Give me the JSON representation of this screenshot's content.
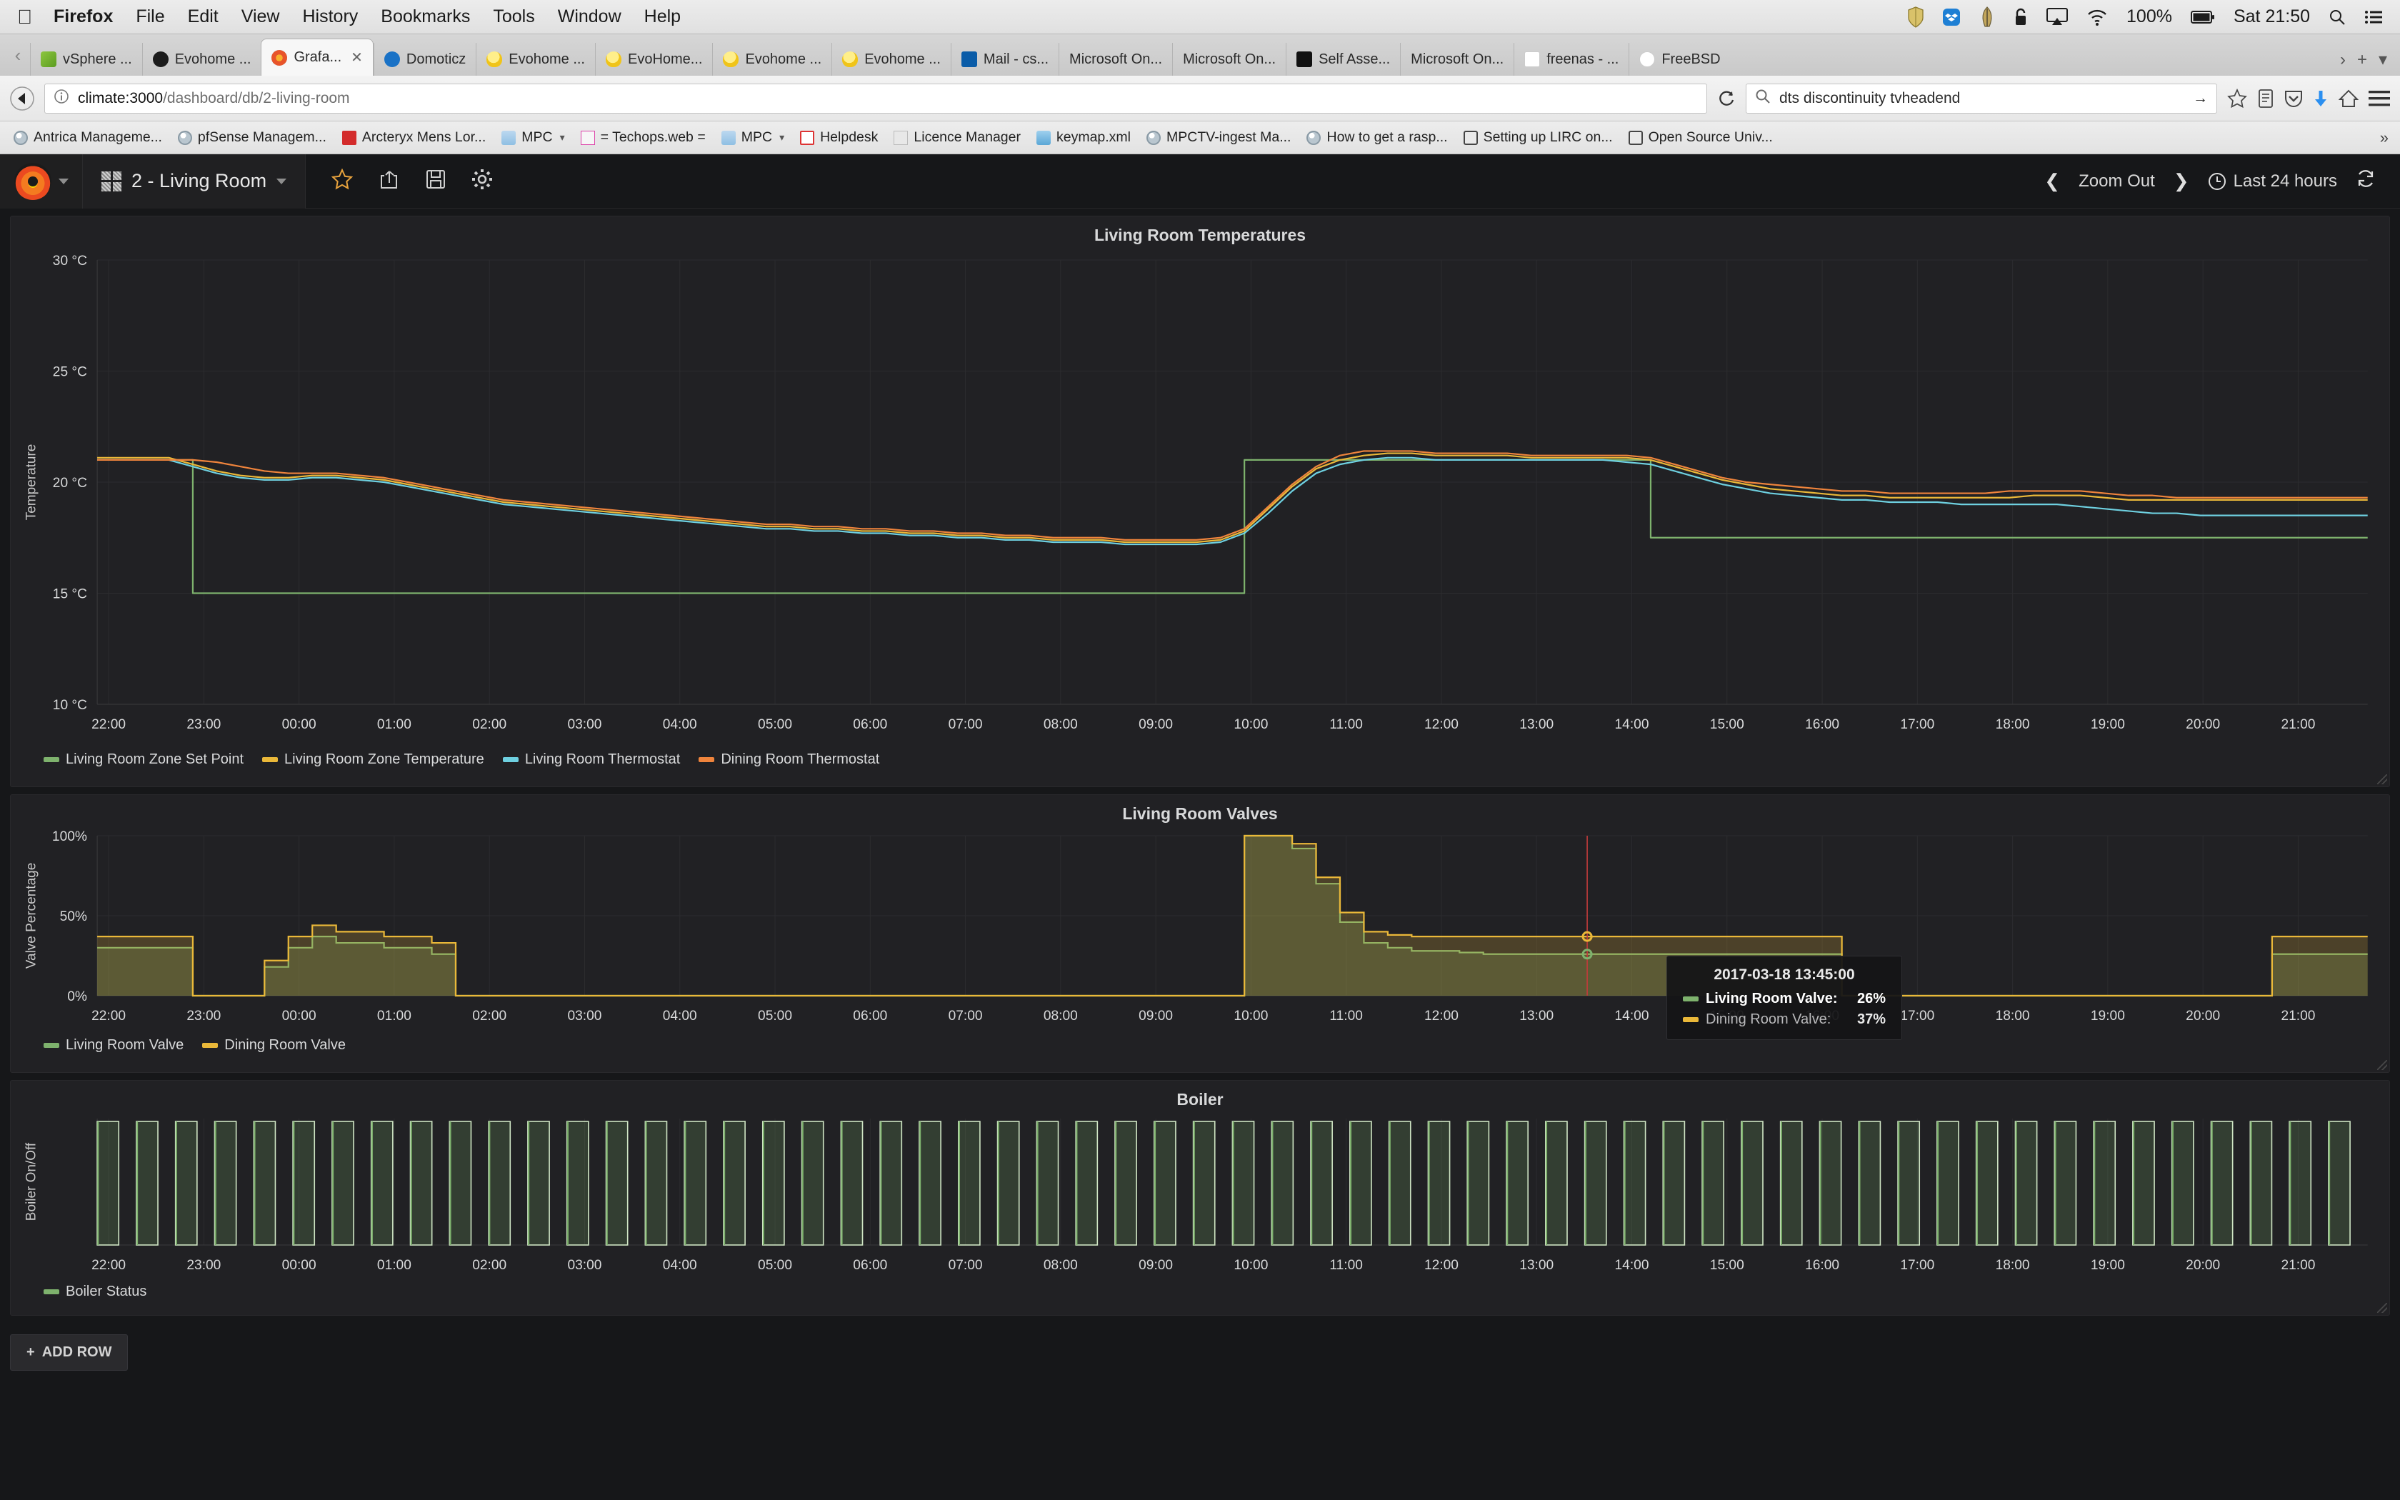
{
  "macbar": {
    "apple_icon": "apple-icon",
    "menus": [
      "Firefox",
      "File",
      "Edit",
      "View",
      "History",
      "Bookmarks",
      "Tools",
      "Window",
      "Help"
    ],
    "status_icons": [
      "shield-icon",
      "dropbox-icon",
      "feather-icon",
      "lock-icon",
      "airplay-icon",
      "wifi-icon"
    ],
    "battery": "100%",
    "clock": "Sat 21:50",
    "search_icon": "search-icon",
    "list_icon": "list-icon"
  },
  "tabstrip": {
    "back_arrow": "‹",
    "tabs": [
      {
        "label": "vSphere ...",
        "icon": "vsphere-icon",
        "icon_class": "fav-vs",
        "active": false
      },
      {
        "label": "Evohome ...",
        "icon": "github-icon",
        "icon_class": "fav-gh",
        "active": false
      },
      {
        "label": "Grafa...",
        "icon": "grafana-icon",
        "icon_class": "fav-graf",
        "active": true
      },
      {
        "label": "Domoticz",
        "icon": "domoticz-icon",
        "icon_class": "fav-domo",
        "active": false
      },
      {
        "label": "Evohome ...",
        "icon": "bulb-icon",
        "icon_class": "fav-bulb",
        "active": false
      },
      {
        "label": "EvoHome...",
        "icon": "bulb-icon",
        "icon_class": "fav-bulb",
        "active": false
      },
      {
        "label": "Evohome ...",
        "icon": "bulb-icon",
        "icon_class": "fav-bulb",
        "active": false
      },
      {
        "label": "Evohome ...",
        "icon": "bulb-icon",
        "icon_class": "fav-bulb",
        "active": false
      },
      {
        "label": "Mail - cs...",
        "icon": "outlook-icon",
        "icon_class": "fav-mail",
        "active": false
      },
      {
        "label": "Microsoft On...",
        "icon": "none",
        "icon_class": "",
        "active": false
      },
      {
        "label": "Microsoft On...",
        "icon": "none",
        "icon_class": "",
        "active": false
      },
      {
        "label": "Self Asse...",
        "icon": "crown-icon",
        "icon_class": "fav-crown",
        "active": false
      },
      {
        "label": "Microsoft On...",
        "icon": "none",
        "icon_class": "",
        "active": false
      },
      {
        "label": "freenas - ...",
        "icon": "freenas-icon",
        "icon_class": "fav-fn",
        "active": false
      },
      {
        "label": "FreeBSD",
        "icon": "freebsd-icon",
        "icon_class": "fav-bsd",
        "active": false
      }
    ],
    "close_glyph": "✕",
    "overflow_arrow": "›",
    "new_tab": "+",
    "tab_list": "▾"
  },
  "navbar": {
    "back_icon": "back-arrow-icon",
    "info_icon": "page-info-icon",
    "url_host": "climate:3000",
    "url_path": "/dashboard/db/2-living-room",
    "reload_icon": "reload-icon",
    "search_icon": "search-icon",
    "search_value": "dts discontinuity tvheadend",
    "search_go": "→",
    "bookmark_icon": "star-icon",
    "reader_icon": "reader-view-icon",
    "pocket_icon": "pocket-icon",
    "downloads_icon": "download-icon",
    "home_icon": "home-icon",
    "menu_icon": "hamburger-menu-icon"
  },
  "bookmarks": [
    {
      "label": "Antrica Manageme...",
      "icon": "globe-icon",
      "icon_class": "fav-globe",
      "chevron": false
    },
    {
      "label": "pfSense Managem...",
      "icon": "globe-icon",
      "icon_class": "fav-globe",
      "chevron": false
    },
    {
      "label": "Arcteryx Mens Lor...",
      "icon": "acrobat-icon",
      "icon_class": "ico-acrobat",
      "chevron": false
    },
    {
      "label": "MPC",
      "icon": "folder-icon",
      "icon_class": "ico-folder",
      "chevron": true
    },
    {
      "label": "= Techops.web =",
      "icon": "techops-icon",
      "icon_class": "ico-to",
      "chevron": false
    },
    {
      "label": "MPC",
      "icon": "folder-icon",
      "icon_class": "ico-folder",
      "chevron": true
    },
    {
      "label": "Helpdesk",
      "icon": "checkbox-icon",
      "icon_class": "ico-check",
      "chevron": false
    },
    {
      "label": "Licence Manager",
      "icon": "mpc-icon",
      "icon_class": "ico-mpc",
      "chevron": false
    },
    {
      "label": "keymap.xml",
      "icon": "keymap-icon",
      "icon_class": "ico-key",
      "chevron": false
    },
    {
      "label": "MPCTV-ingest Ma...",
      "icon": "globe-icon",
      "icon_class": "fav-globe",
      "chevron": false
    },
    {
      "label": "How to get a rasp...",
      "icon": "globe-icon",
      "icon_class": "fav-globe",
      "chevron": false
    },
    {
      "label": "Setting up LIRC on...",
      "icon": "doc-icon",
      "icon_class": "ico-sq",
      "chevron": false
    },
    {
      "label": "Open Source Univ...",
      "icon": "doc-icon",
      "icon_class": "ico-sq",
      "chevron": false
    }
  ],
  "bookmarks_overflow": "»",
  "grafana": {
    "logo_icon": "grafana-logo-icon",
    "dashboard_grid_icon": "dashboard-grid-icon",
    "dashboard_title": "2 - Living Room",
    "tools": [
      {
        "name": "star-icon",
        "glyph": "☆"
      },
      {
        "name": "share-icon",
        "glyph": "➶"
      },
      {
        "name": "save-icon",
        "glyph": "Ὃe"
      },
      {
        "name": "settings-gear-icon",
        "glyph": "⚙"
      }
    ],
    "zoom_prev": "❮",
    "zoom_out_label": "Zoom Out",
    "zoom_next": "❯",
    "clock_icon": "clock-icon",
    "time_range": "Last 24 hours",
    "refresh_icon": "refresh-icon",
    "add_row_label": "ADD ROW",
    "add_row_plus": "+"
  },
  "tooltip": {
    "time": "2017-03-18 13:45:00",
    "rows": [
      {
        "label": "Living Room Valve:",
        "value": "26%",
        "color": "#7eb26d",
        "highlight": true
      },
      {
        "label": "Dining Room Valve:",
        "value": "37%",
        "color": "#eab839",
        "highlight": false
      }
    ]
  },
  "chart_data": [
    {
      "type": "line",
      "title": "Living Room Temperatures",
      "ylabel": "Temperature",
      "xlabel": "",
      "ylim": [
        10,
        30
      ],
      "yticks": [
        10,
        15,
        20,
        25,
        30
      ],
      "ytick_labels": [
        "10 °C",
        "15 °C",
        "20 °C",
        "25 °C",
        "30 °C"
      ],
      "xtick_labels": [
        "22:00",
        "23:00",
        "00:00",
        "01:00",
        "02:00",
        "03:00",
        "04:00",
        "05:00",
        "06:00",
        "07:00",
        "08:00",
        "09:00",
        "10:00",
        "11:00",
        "12:00",
        "13:00",
        "14:00",
        "15:00",
        "16:00",
        "17:00",
        "18:00",
        "19:00",
        "20:00",
        "21:00"
      ],
      "grid": true,
      "legend_position": "bottom",
      "series": [
        {
          "name": "Living Room Zone Set Point",
          "color": "#7eb26d",
          "values": [
            21.0,
            21.0,
            21.0,
            21.0,
            15.0,
            15.0,
            15.0,
            15.0,
            15.0,
            15.0,
            15.0,
            15.0,
            15.0,
            15.0,
            15.0,
            15.0,
            15.0,
            15.0,
            15.0,
            15.0,
            15.0,
            15.0,
            15.0,
            15.0,
            15.0,
            15.0,
            15.0,
            15.0,
            15.0,
            15.0,
            15.0,
            15.0,
            15.0,
            15.0,
            15.0,
            15.0,
            15.0,
            15.0,
            15.0,
            15.0,
            15.0,
            15.0,
            15.0,
            15.0,
            15.0,
            15.0,
            15.0,
            15.0,
            21.0,
            21.0,
            21.0,
            21.0,
            21.0,
            21.0,
            21.0,
            21.0,
            21.0,
            21.0,
            21.0,
            21.0,
            21.0,
            21.0,
            21.0,
            21.0,
            21.0,
            17.5,
            17.5,
            17.5,
            17.5,
            17.5,
            17.5,
            17.5,
            17.5,
            17.5,
            17.5,
            17.5,
            17.5,
            17.5,
            17.5,
            17.5,
            17.5,
            17.5,
            17.5,
            17.5,
            17.5,
            17.5,
            17.5,
            17.5,
            17.5,
            17.5,
            17.5,
            17.5,
            17.5,
            17.5,
            17.5,
            17.5
          ]
        },
        {
          "name": "Living Room Zone Temperature",
          "color": "#eab839",
          "values": [
            21.1,
            21.1,
            21.1,
            21.1,
            20.8,
            20.5,
            20.3,
            20.2,
            20.2,
            20.3,
            20.3,
            20.2,
            20.1,
            19.9,
            19.7,
            19.5,
            19.3,
            19.1,
            19.0,
            18.9,
            18.8,
            18.7,
            18.6,
            18.5,
            18.4,
            18.3,
            18.2,
            18.1,
            18.0,
            18.0,
            17.9,
            17.9,
            17.8,
            17.8,
            17.7,
            17.7,
            17.6,
            17.6,
            17.5,
            17.5,
            17.4,
            17.4,
            17.4,
            17.3,
            17.3,
            17.3,
            17.3,
            17.4,
            17.8,
            18.8,
            19.8,
            20.6,
            21.0,
            21.2,
            21.3,
            21.3,
            21.2,
            21.2,
            21.2,
            21.2,
            21.1,
            21.1,
            21.1,
            21.1,
            21.1,
            21.0,
            20.7,
            20.4,
            20.1,
            19.9,
            19.7,
            19.6,
            19.5,
            19.4,
            19.4,
            19.3,
            19.3,
            19.3,
            19.3,
            19.3,
            19.3,
            19.4,
            19.4,
            19.4,
            19.3,
            19.2,
            19.2,
            19.2,
            19.2,
            19.2,
            19.2,
            19.2,
            19.2,
            19.2,
            19.2,
            19.2
          ]
        },
        {
          "name": "Living Room Thermostat",
          "color": "#6ed0e0",
          "values": [
            21.0,
            21.0,
            21.0,
            21.0,
            20.7,
            20.4,
            20.2,
            20.1,
            20.1,
            20.2,
            20.2,
            20.1,
            20.0,
            19.8,
            19.6,
            19.4,
            19.2,
            19.0,
            18.9,
            18.8,
            18.7,
            18.6,
            18.5,
            18.4,
            18.3,
            18.2,
            18.1,
            18.0,
            17.9,
            17.9,
            17.8,
            17.8,
            17.7,
            17.7,
            17.6,
            17.6,
            17.5,
            17.5,
            17.4,
            17.4,
            17.3,
            17.3,
            17.3,
            17.2,
            17.2,
            17.2,
            17.2,
            17.3,
            17.7,
            18.6,
            19.6,
            20.4,
            20.8,
            21.0,
            21.1,
            21.1,
            21.0,
            21.0,
            21.0,
            21.0,
            21.0,
            21.0,
            21.0,
            21.0,
            20.9,
            20.8,
            20.5,
            20.2,
            19.9,
            19.7,
            19.5,
            19.4,
            19.3,
            19.2,
            19.2,
            19.1,
            19.1,
            19.1,
            19.0,
            19.0,
            19.0,
            19.0,
            19.0,
            18.9,
            18.8,
            18.7,
            18.6,
            18.6,
            18.5,
            18.5,
            18.5,
            18.5,
            18.5,
            18.5,
            18.5,
            18.5
          ]
        },
        {
          "name": "Dining Room Thermostat",
          "color": "#ef843c",
          "values": [
            21.0,
            21.0,
            21.0,
            21.0,
            21.0,
            20.9,
            20.7,
            20.5,
            20.4,
            20.4,
            20.4,
            20.3,
            20.2,
            20.0,
            19.8,
            19.6,
            19.4,
            19.2,
            19.1,
            19.0,
            18.9,
            18.8,
            18.7,
            18.6,
            18.5,
            18.4,
            18.3,
            18.2,
            18.1,
            18.1,
            18.0,
            18.0,
            17.9,
            17.9,
            17.8,
            17.8,
            17.7,
            17.7,
            17.6,
            17.6,
            17.5,
            17.5,
            17.5,
            17.4,
            17.4,
            17.4,
            17.4,
            17.5,
            17.9,
            18.9,
            19.9,
            20.7,
            21.2,
            21.4,
            21.4,
            21.4,
            21.3,
            21.3,
            21.3,
            21.3,
            21.2,
            21.2,
            21.2,
            21.2,
            21.2,
            21.1,
            20.8,
            20.5,
            20.2,
            20.0,
            19.9,
            19.8,
            19.7,
            19.6,
            19.6,
            19.5,
            19.5,
            19.5,
            19.5,
            19.5,
            19.6,
            19.6,
            19.6,
            19.6,
            19.5,
            19.4,
            19.4,
            19.3,
            19.3,
            19.3,
            19.3,
            19.3,
            19.3,
            19.3,
            19.3,
            19.3
          ]
        }
      ]
    },
    {
      "type": "area",
      "title": "Living Room Valves",
      "ylabel": "Valve Percentage",
      "xlabel": "",
      "ylim": [
        0,
        100
      ],
      "yticks": [
        0,
        50,
        100
      ],
      "ytick_labels": [
        "0%",
        "50%",
        "100%"
      ],
      "xtick_labels": [
        "22:00",
        "23:00",
        "00:00",
        "01:00",
        "02:00",
        "03:00",
        "04:00",
        "05:00",
        "06:00",
        "07:00",
        "08:00",
        "09:00",
        "10:00",
        "11:00",
        "12:00",
        "13:00",
        "14:00",
        "15:00",
        "16:00",
        "17:00",
        "18:00",
        "19:00",
        "20:00",
        "21:00"
      ],
      "grid": true,
      "legend_position": "bottom",
      "series": [
        {
          "name": "Living Room Valve",
          "color": "#7eb26d",
          "values": [
            30,
            30,
            30,
            30,
            0,
            0,
            0,
            18,
            30,
            37,
            33,
            33,
            30,
            30,
            26,
            0,
            0,
            0,
            0,
            0,
            0,
            0,
            0,
            0,
            0,
            0,
            0,
            0,
            0,
            0,
            0,
            0,
            0,
            0,
            0,
            0,
            0,
            0,
            0,
            0,
            0,
            0,
            0,
            0,
            0,
            0,
            0,
            0,
            100,
            100,
            92,
            70,
            46,
            33,
            30,
            28,
            28,
            27,
            26,
            26,
            26,
            26,
            26,
            26,
            26,
            26,
            26,
            26,
            26,
            26,
            26,
            26,
            26,
            0,
            0,
            0,
            0,
            0,
            0,
            0,
            0,
            0,
            0,
            0,
            0,
            0,
            0,
            0,
            0,
            0,
            0,
            26,
            26,
            26,
            26,
            26
          ]
        },
        {
          "name": "Dining Room Valve",
          "color": "#eab839",
          "values": [
            37,
            37,
            37,
            37,
            0,
            0,
            0,
            22,
            37,
            44,
            40,
            40,
            37,
            37,
            33,
            0,
            0,
            0,
            0,
            0,
            0,
            0,
            0,
            0,
            0,
            0,
            0,
            0,
            0,
            0,
            0,
            0,
            0,
            0,
            0,
            0,
            0,
            0,
            0,
            0,
            0,
            0,
            0,
            0,
            0,
            0,
            0,
            0,
            100,
            100,
            95,
            74,
            52,
            40,
            38,
            37,
            37,
            37,
            37,
            37,
            37,
            37,
            37,
            37,
            37,
            37,
            37,
            37,
            37,
            37,
            37,
            37,
            37,
            0,
            0,
            0,
            0,
            0,
            0,
            0,
            0,
            0,
            0,
            0,
            0,
            0,
            0,
            0,
            0,
            0,
            0,
            37,
            37,
            37,
            37,
            37
          ]
        }
      ]
    },
    {
      "type": "area",
      "title": "Boiler",
      "ylabel": "Boiler On/Off",
      "xlabel": "",
      "ylim": [
        0,
        1
      ],
      "yticks": [],
      "ytick_labels": [],
      "xtick_labels": [
        "22:00",
        "23:00",
        "00:00",
        "01:00",
        "02:00",
        "03:00",
        "04:00",
        "05:00",
        "06:00",
        "07:00",
        "08:00",
        "09:00",
        "10:00",
        "11:00",
        "12:00",
        "13:00",
        "14:00",
        "15:00",
        "16:00",
        "17:00",
        "18:00",
        "19:00",
        "20:00",
        "21:00"
      ],
      "grid": false,
      "legend_position": "bottom",
      "series": [
        {
          "name": "Boiler Status",
          "color": "#7eb26d",
          "duty_cycle": 0.55,
          "pulses_per_hour": 2.4
        }
      ]
    }
  ]
}
